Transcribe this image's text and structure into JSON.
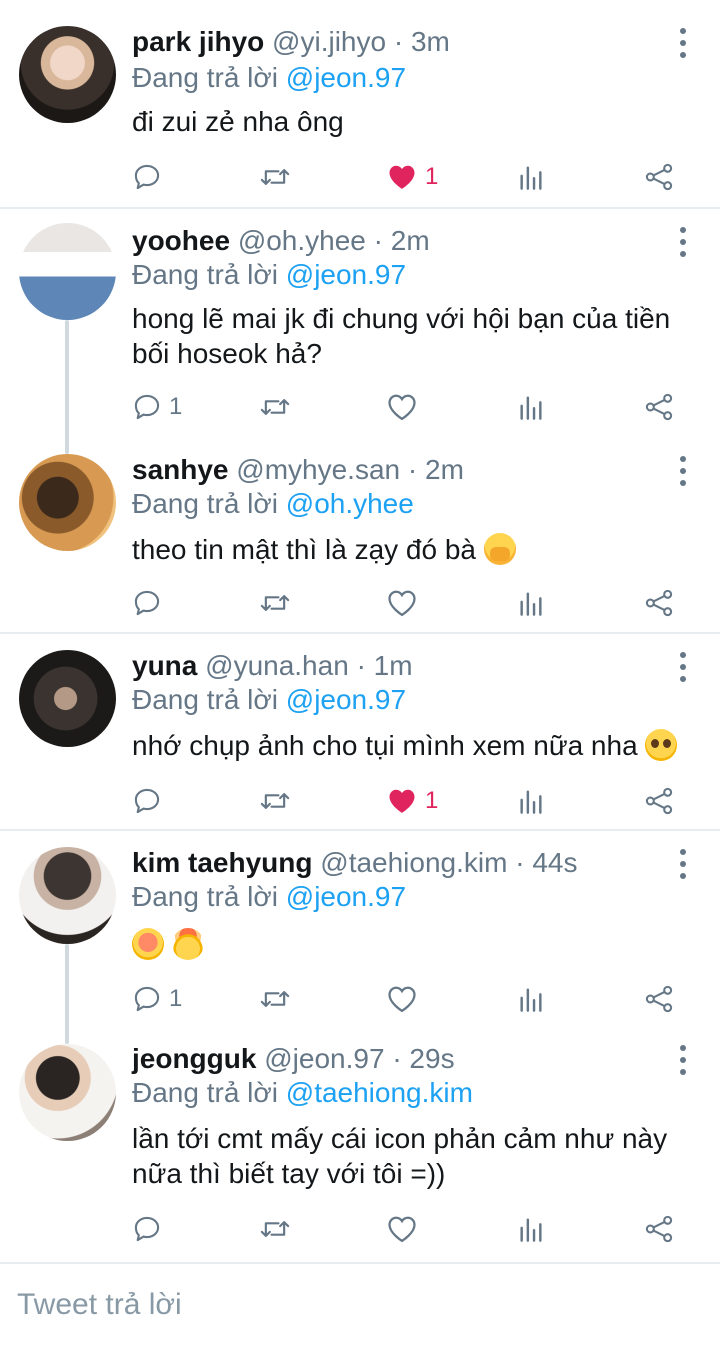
{
  "icons": {
    "reply": "speech-bubble-icon",
    "retweet": "retweet-arrows-icon",
    "like": "heart-icon",
    "stats": "bar-chart-icon",
    "share": "share-icon",
    "more": "vertical-dots-icon"
  },
  "colors": {
    "link": "#1da1f2",
    "muted": "#657786",
    "like_active": "#e0245e",
    "divider": "#e6ecf0"
  },
  "replies_prefix": "Đang trả lời",
  "tweets": [
    {
      "name": "park jihyo",
      "handle": "@yi.jihyo",
      "time": "3m",
      "reply_to": "@jeon.97",
      "text": "đi zui zẻ nha ông",
      "reply_count": "",
      "like_count": "1",
      "liked": true
    },
    {
      "name": "yoohee",
      "handle": "@oh.yhee",
      "time": "2m",
      "reply_to": "@jeon.97",
      "text": "hong lẽ mai jk đi chung với hội bạn của tiền bối hoseok hả?",
      "reply_count": "1",
      "like_count": "",
      "liked": false
    },
    {
      "name": "sanhye",
      "handle": "@myhye.san",
      "time": "2m",
      "reply_to": "@oh.yhee",
      "text": "theo tin mật thì là zạy đó bà",
      "emoji": [
        "hand-over-mouth-emoji"
      ],
      "reply_count": "",
      "like_count": "",
      "liked": false
    },
    {
      "name": "yuna",
      "handle": "@yuna.han",
      "time": "1m",
      "reply_to": "@jeon.97",
      "text": "nhớ chụp ảnh cho tụi mình xem nữa nha",
      "emoji": [
        "pleading-face-emoji"
      ],
      "reply_count": "",
      "like_count": "1",
      "liked": true
    },
    {
      "name": "kim taehyung",
      "handle": "@taehiong.kim",
      "time": "44s",
      "reply_to": "@jeon.97",
      "text": "",
      "emoji": [
        "flushed-face-emoji",
        "exploding-head-emoji"
      ],
      "reply_count": "1",
      "like_count": "",
      "liked": false
    },
    {
      "name": "jeongguk",
      "handle": "@jeon.97",
      "time": "29s",
      "reply_to": "@taehiong.kim",
      "text": "lần tới cmt mấy cái icon phản cảm như này nữa thì biết tay với tôi =))",
      "reply_count": "",
      "like_count": "",
      "liked": false
    }
  ],
  "composer": {
    "placeholder": "Tweet trả lời"
  }
}
